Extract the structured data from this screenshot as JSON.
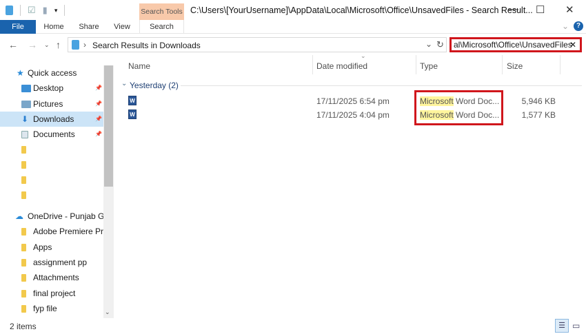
{
  "window": {
    "title": "C:\\Users\\[YourUsername]\\AppData\\Local\\Microsoft\\Office\\UnsavedFiles - Search Result...",
    "context_tab": "Search Tools"
  },
  "ribbon": {
    "tabs": [
      "File",
      "Home",
      "Share",
      "View",
      "Search"
    ]
  },
  "address": {
    "crumb": "Search Results in Downloads"
  },
  "search": {
    "value": "al\\Microsoft\\Office\\UnsavedFiles"
  },
  "sidebar": {
    "items": [
      {
        "label": "Quick access",
        "icon": "star-icon"
      },
      {
        "label": "Desktop",
        "icon": "desktop-icon",
        "pinned": true
      },
      {
        "label": "Pictures",
        "icon": "pictures-icon",
        "pinned": true
      },
      {
        "label": "Downloads",
        "icon": "download-icon",
        "pinned": true,
        "selected": true
      },
      {
        "label": "Documents",
        "icon": "documents-icon",
        "pinned": true
      },
      {
        "label": "",
        "icon": "folder-icon"
      },
      {
        "label": "",
        "icon": "folder-icon"
      },
      {
        "label": "",
        "icon": "folder-icon"
      },
      {
        "label": "",
        "icon": "folder-icon"
      },
      {
        "label": "OneDrive - Punjab Gro",
        "icon": "cloud-icon"
      },
      {
        "label": "Adobe Premiere Pro",
        "icon": "folder-icon"
      },
      {
        "label": "Apps",
        "icon": "folder-icon"
      },
      {
        "label": "assignment pp",
        "icon": "folder-icon"
      },
      {
        "label": "Attachments",
        "icon": "folder-icon"
      },
      {
        "label": "final project",
        "icon": "folder-icon"
      },
      {
        "label": "fyp file",
        "icon": "folder-icon"
      }
    ]
  },
  "columns": {
    "name": "Name",
    "date": "Date modified",
    "type": "Type",
    "size": "Size"
  },
  "group": "Yesterday (2)",
  "files": [
    {
      "date": "17/11/2025 6:54 pm",
      "type_hl": "Microsoft",
      "type_rest": " Word Doc...",
      "size": "5,946 KB"
    },
    {
      "date": "17/11/2025 4:04 pm",
      "type_hl": "Microsoft",
      "type_rest": " Word Doc...",
      "size": "1,577 KB"
    }
  ],
  "status": {
    "count": "2 items"
  }
}
